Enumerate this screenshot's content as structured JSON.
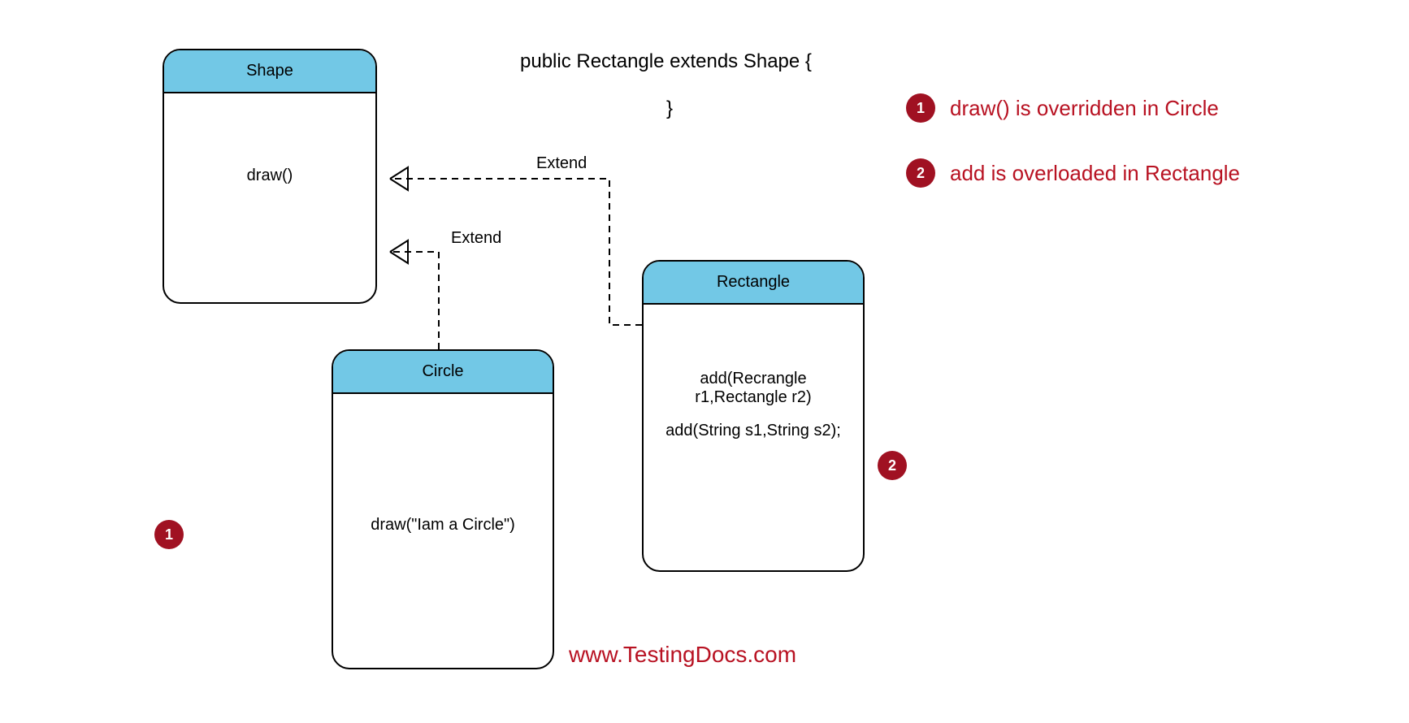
{
  "code": {
    "line1": "public Rectangle extends Shape {",
    "line2": "}"
  },
  "classes": {
    "shape": {
      "name": "Shape",
      "methods": [
        "draw()"
      ]
    },
    "circle": {
      "name": "Circle",
      "methods": [
        "draw(\"Iam a Circle\")"
      ]
    },
    "rectangle": {
      "name": "Rectangle",
      "methods": [
        "add(Recrangle r1,Rectangle r2)",
        "add(String s1,String s2);"
      ]
    }
  },
  "arrows": {
    "extend_label": "Extend"
  },
  "notes": {
    "n1": {
      "num": "1",
      "text": "draw() is overridden in Circle"
    },
    "n2": {
      "num": "2",
      "text": "add is overloaded in Rectangle"
    }
  },
  "badges": {
    "left": "1",
    "right": "2"
  },
  "website": "www.TestingDocs.com"
}
